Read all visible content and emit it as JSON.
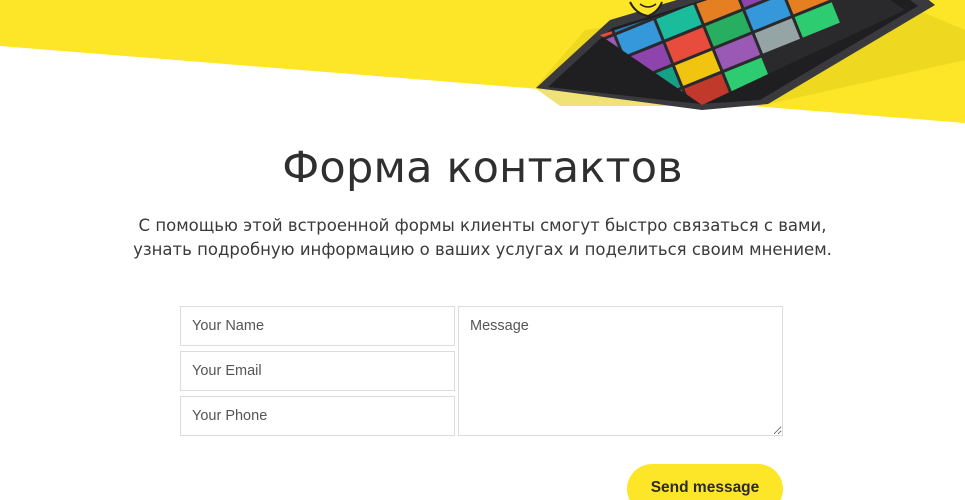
{
  "contact": {
    "title": "Форма контактов",
    "subtitle": "С помощью этой встроенной формы клиенты смогут быстро связаться с вами, узнать подробную информацию о ваших услугах и поделиться своим мнением.",
    "fields": {
      "name_placeholder": "Your Name",
      "email_placeholder": "Your Email",
      "phone_placeholder": "Your Phone",
      "message_placeholder": "Message"
    },
    "send_label": "Send message"
  },
  "colors": {
    "accent_yellow": "#fde527",
    "title_text": "#2f2f2f",
    "field_border": "#dcdcdc"
  },
  "hero": {
    "image": "phone-mockup-with-colorful-tiles"
  }
}
